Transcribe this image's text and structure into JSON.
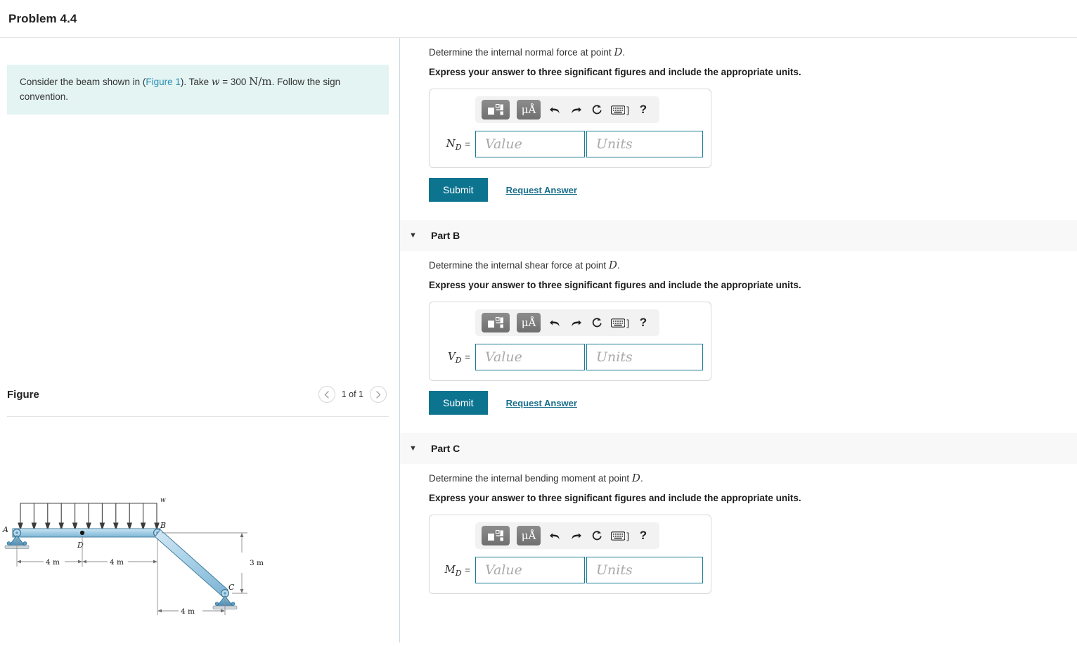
{
  "header": {
    "title": "Problem 4.4"
  },
  "statement": {
    "text_before_link": "Consider the beam shown in (",
    "link_label": "Figure 1",
    "text_after_link": "). Take ",
    "symbol_w": "w",
    "equals": " = ",
    "value": "300",
    "units": "N/m",
    "text_tail": ". Follow the sign convention."
  },
  "figure_panel": {
    "title": "Figure",
    "prev_icon": "chevron-left-icon",
    "next_icon": "chevron-right-icon",
    "counter": "1 of 1"
  },
  "figure": {
    "load_label": "w",
    "point_a": "A",
    "point_b": "B",
    "point_c": "C",
    "point_d": "D",
    "dim_ad": "4 m",
    "dim_db": "4 m",
    "dim_height": "3 m",
    "dim_bottom": "4 m",
    "beam_fill": "#a8d0e6",
    "beam_stroke": "#4a7f9e",
    "support_fill": "#5b9bc4"
  },
  "toolbar": {
    "template_icon": "math-template-icon",
    "units_icon": "micro-angstrom-units-icon",
    "undo_icon": "undo-arrow-icon",
    "redo_icon": "redo-arrow-icon",
    "reset_icon": "reset-circular-arrow-icon",
    "keyboard_icon": "keyboard-icon",
    "keyboard_suffix": "]",
    "help_icon": "?",
    "units_label": "μÅ"
  },
  "inputs": {
    "value_placeholder": "Value",
    "units_placeholder": "Units"
  },
  "actions": {
    "submit_label": "Submit",
    "request_label": "Request Answer"
  },
  "parts": [
    {
      "id": "part-a",
      "band_label": "",
      "has_band": false,
      "question": "Determine the internal normal force at point ",
      "question_symbol": "D",
      "question_tail": ".",
      "instruction": "Express your answer to three significant figures and include the appropriate units.",
      "answer_symbol": "N",
      "answer_subscript": "D",
      "answer_equals": "="
    },
    {
      "id": "part-b",
      "band_label": "Part B",
      "has_band": true,
      "question": "Determine the internal shear force at point ",
      "question_symbol": "D",
      "question_tail": ".",
      "instruction": "Express your answer to three significant figures and include the appropriate units.",
      "answer_symbol": "V",
      "answer_subscript": "D",
      "answer_equals": "="
    },
    {
      "id": "part-c",
      "band_label": "Part C",
      "has_band": true,
      "question": "Determine the internal bending moment at point ",
      "question_symbol": "D",
      "question_tail": ".",
      "instruction": "Express your answer to three significant figures and include the appropriate units.",
      "answer_symbol": "M",
      "answer_subscript": "D",
      "answer_equals": "="
    }
  ],
  "colors": {
    "accent_teal": "#0d7490",
    "hint_bg": "#e3f4f2",
    "band_bg": "#f8f8f8",
    "link": "#2b8fb3"
  }
}
